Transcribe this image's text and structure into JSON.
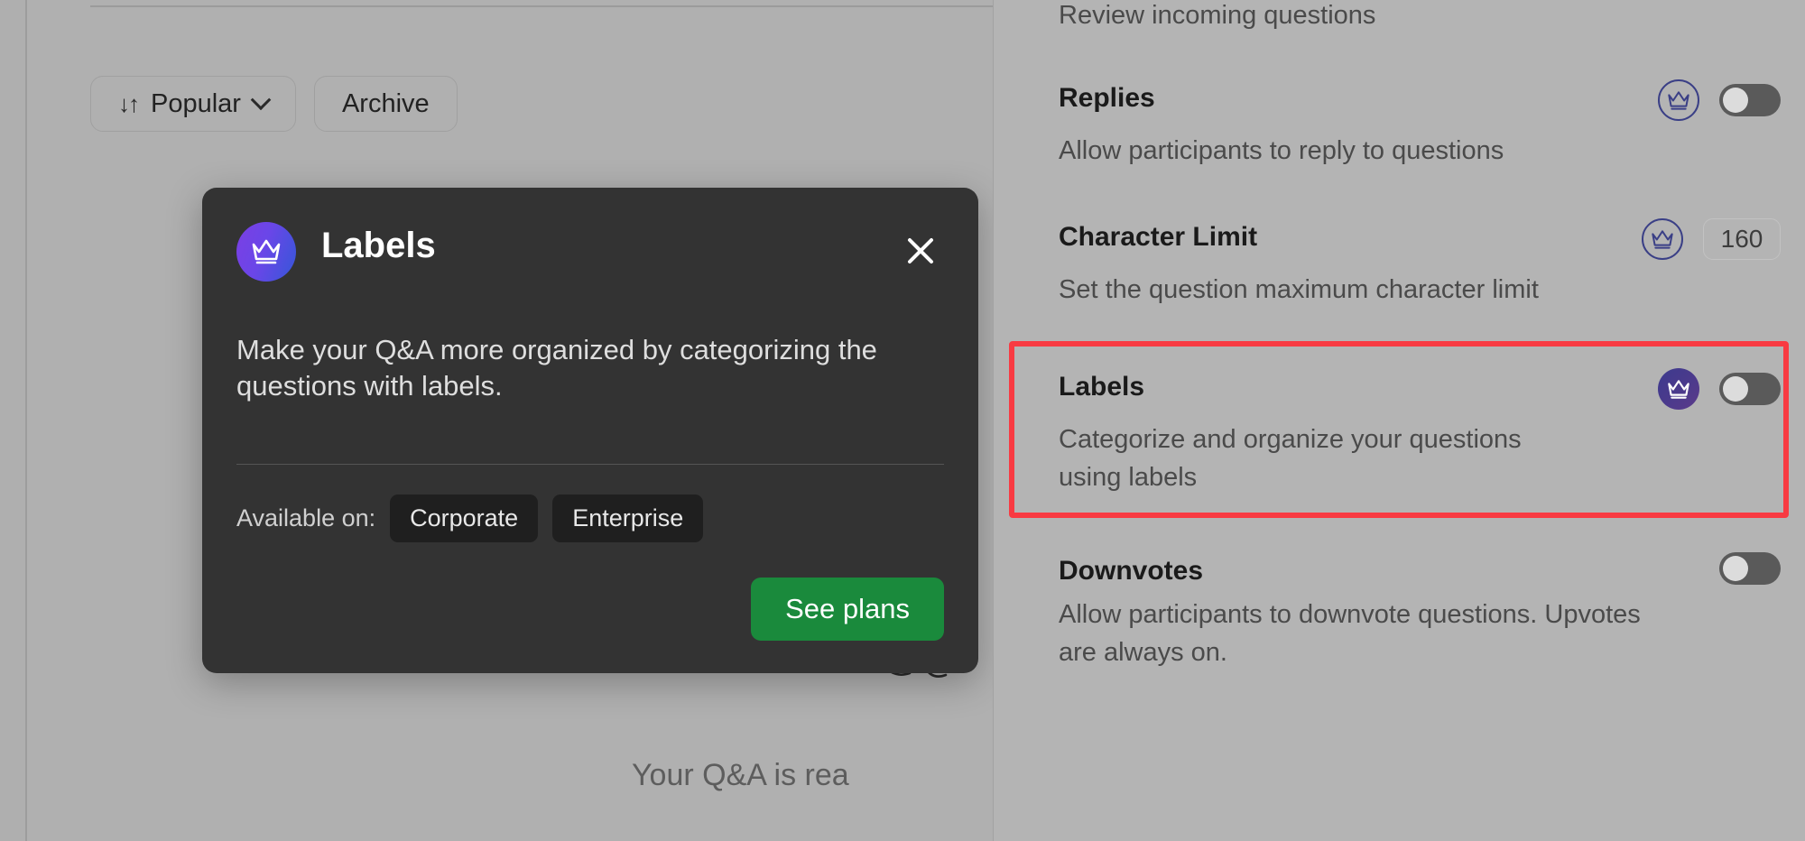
{
  "toolbar": {
    "sort_button": {
      "label": "Popular",
      "sort_glyph": "sort-icon",
      "chevron": "chevron-down-icon"
    },
    "archive_button": {
      "label": "Archive"
    }
  },
  "empty_state": {
    "text": "Your Q&A is rea"
  },
  "modal": {
    "icon": "crown-icon",
    "title": "Labels",
    "close": "close-icon",
    "body": "Make your Q&A more organized by categorizing the questions with labels.",
    "available_label": "Available on:",
    "plans": [
      "Corporate",
      "Enterprise"
    ],
    "cta": "See plans"
  },
  "panel": {
    "moderation_desc": "Review incoming questions",
    "rows": [
      {
        "title": "Replies",
        "desc": "Allow participants to reply to questions",
        "badge": "crown-outline-icon",
        "control": "toggle",
        "toggle_state": "off"
      },
      {
        "title": "Character Limit",
        "desc": "Set the question maximum character limit",
        "badge": "crown-outline-icon",
        "control": "value-box",
        "value": "160"
      },
      {
        "title": "Labels",
        "desc": "Categorize and organize your questions using labels",
        "badge": "crown-filled-icon",
        "control": "toggle",
        "toggle_state": "off",
        "highlighted": true
      },
      {
        "title": "Downvotes",
        "desc": "Allow participants to downvote questions. Upvotes are always on.",
        "badge": null,
        "control": "toggle",
        "toggle_state": "off"
      }
    ]
  },
  "colors": {
    "accent_green": "#1a8a3c",
    "highlight_red": "#f83a42",
    "crown_gradient_start": "#7b3fe4",
    "crown_gradient_end": "#3557d8",
    "modal_bg": "#333333",
    "panel_bg": "#b4b4b4"
  }
}
